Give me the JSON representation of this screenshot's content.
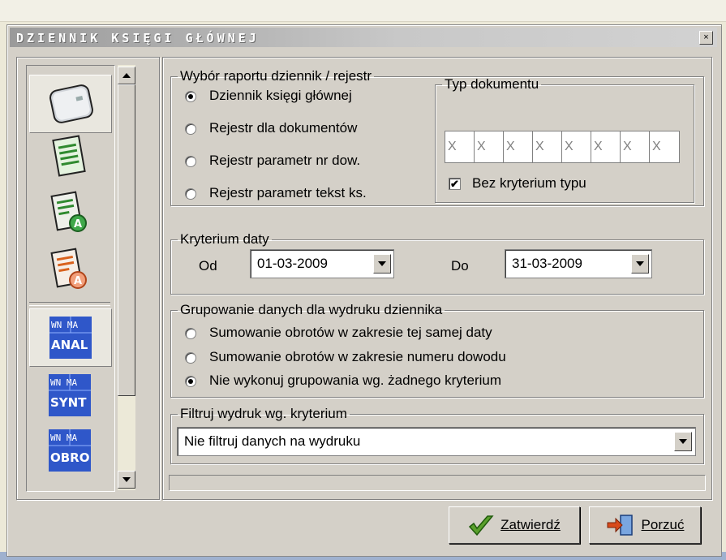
{
  "window": {
    "title": "DZIENNIK KSIĘGI GŁÓWNEJ",
    "close_glyph": "×"
  },
  "left_tools": [
    {
      "icon": "book-icon"
    },
    {
      "icon": "list-document-icon"
    },
    {
      "icon": "document-a-green-icon"
    },
    {
      "icon": "document-a-orange-icon"
    },
    {
      "icon": "wn-ma-anal-icon",
      "line1": "WN MA",
      "line2": "ANAL"
    },
    {
      "icon": "wn-ma-synt-icon",
      "line1": "WN MA",
      "line2": "SYNT"
    },
    {
      "icon": "wn-ma-obro-icon",
      "line1": "WN MA",
      "line2": "OBRO"
    }
  ],
  "report": {
    "legend": "Wybór raportu dziennik / rejestr",
    "options": [
      {
        "label": "Dziennik księgi głównej",
        "selected": true
      },
      {
        "label": "Rejestr dla dokumentów",
        "selected": false
      },
      {
        "label": "Rejestr parametr nr dow.",
        "selected": false
      },
      {
        "label": "Rejestr parametr tekst ks.",
        "selected": false
      }
    ]
  },
  "doc_type": {
    "legend": "Typ dokumentu",
    "cells": [
      "X",
      "X",
      "X",
      "X",
      "X",
      "X",
      "X",
      "X"
    ],
    "checkbox_label": "Bez kryterium typu",
    "checkbox_checked": true,
    "check_glyph": "✔"
  },
  "date": {
    "legend": "Kryterium daty",
    "from_label": "Od",
    "from_value": "01-03-2009",
    "to_label": "Do",
    "to_value": "31-03-2009"
  },
  "grouping": {
    "legend": "Grupowanie danych dla wydruku dziennika",
    "options": [
      {
        "label": "Sumowanie obrotów w zakresie  tej  samej  daty",
        "selected": false
      },
      {
        "label": "Sumowanie obrotów w zakresie numeru dowodu",
        "selected": false
      },
      {
        "label": "Nie wykonuj  grupowania wg. żadnego kryterium",
        "selected": true
      }
    ]
  },
  "filter": {
    "legend": "Filtruj wydruk wg. kryterium",
    "selected": "Nie filtruj danych na wydruku"
  },
  "buttons": {
    "confirm": "Zatwierdź",
    "cancel": "Porzuć"
  },
  "colors": {
    "title_text": "#ffffff",
    "anal_bg": "#2f57c9",
    "confirm_icon": "#5aa02c",
    "cancel_icon": "#d84a1b"
  }
}
